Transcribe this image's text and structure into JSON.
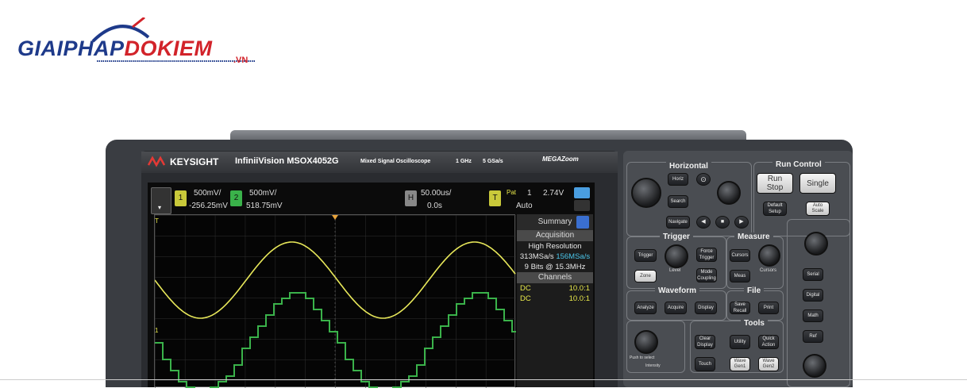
{
  "logo": {
    "main_left": "GIAIPHAP",
    "main_right": "DOKIEM",
    "suffix": ".VN"
  },
  "scope": {
    "brand": "KEYSIGHT",
    "model": "InfiniiVision MSOX4052G",
    "subtitle": "Mixed Signal Oscilloscope",
    "bandwidth": "1 GHz",
    "samplerate": "5 GSa/s",
    "megazoom": "MEGAZoom",
    "screen": {
      "ch1": {
        "num": "1",
        "scale": "500mV/",
        "offset": "-256.25mV",
        "color": "#e8e84a"
      },
      "ch2": {
        "num": "2",
        "scale": "500mV/",
        "offset": "518.75mV",
        "color": "#3ab24a"
      },
      "horiz": {
        "tag": "H",
        "scale": "50.00us/",
        "delay": "0.0s"
      },
      "trig": {
        "tag": "T",
        "label": "Pat",
        "source": "1",
        "level": "2.74V",
        "mode": "Auto"
      },
      "summary": "Summary",
      "acq_header": "Acquisition",
      "acq_mode": "High Resolution",
      "acq_rate_a": "313MSa/s",
      "acq_rate_b": "156MSa/s",
      "acq_bits": "9 Bits @ 15.3MHz",
      "channels_header": "Channels",
      "channels": [
        {
          "coupling": "DC",
          "probe": "10.0:1"
        },
        {
          "coupling": "DC",
          "probe": "10.0:1"
        }
      ]
    },
    "panel": {
      "horizontal": "Horizontal",
      "run_control": "Run Control",
      "run_stop": "Run\nStop",
      "single": "Single",
      "horiz_btn": "Horiz",
      "search_btn": "Search",
      "navigate_btn": "Navigate",
      "default_setup": "Default Setup",
      "auto_scale": "Auto Scale",
      "trigger": "Trigger",
      "measure": "Measure",
      "trigger_btn": "Trigger",
      "level": "Level",
      "force_trigger": "Force Trigger",
      "cursors_btn": "Cursors",
      "cursors_knob": "Cursors",
      "zone": "Zone",
      "mode_coupling": "Mode Coupling",
      "meas_btn": "Meas",
      "waveform": "Waveform",
      "file": "File",
      "analyze": "Analyze",
      "acquire": "Acquire",
      "display": "Display",
      "save_recall": "Save Recall",
      "print": "Print",
      "tools": "Tools",
      "clear_display": "Clear Display",
      "utility": "Utility",
      "quick_action": "Quick Action",
      "touch": "Touch",
      "wave_gen1": "Wave Gen1",
      "wave_gen2": "Wave Gen2",
      "serial": "Serial",
      "digital": "Digital",
      "math": "Math",
      "ref": "Ref",
      "push_select": "Push to select",
      "intensity": "Intensity"
    }
  }
}
